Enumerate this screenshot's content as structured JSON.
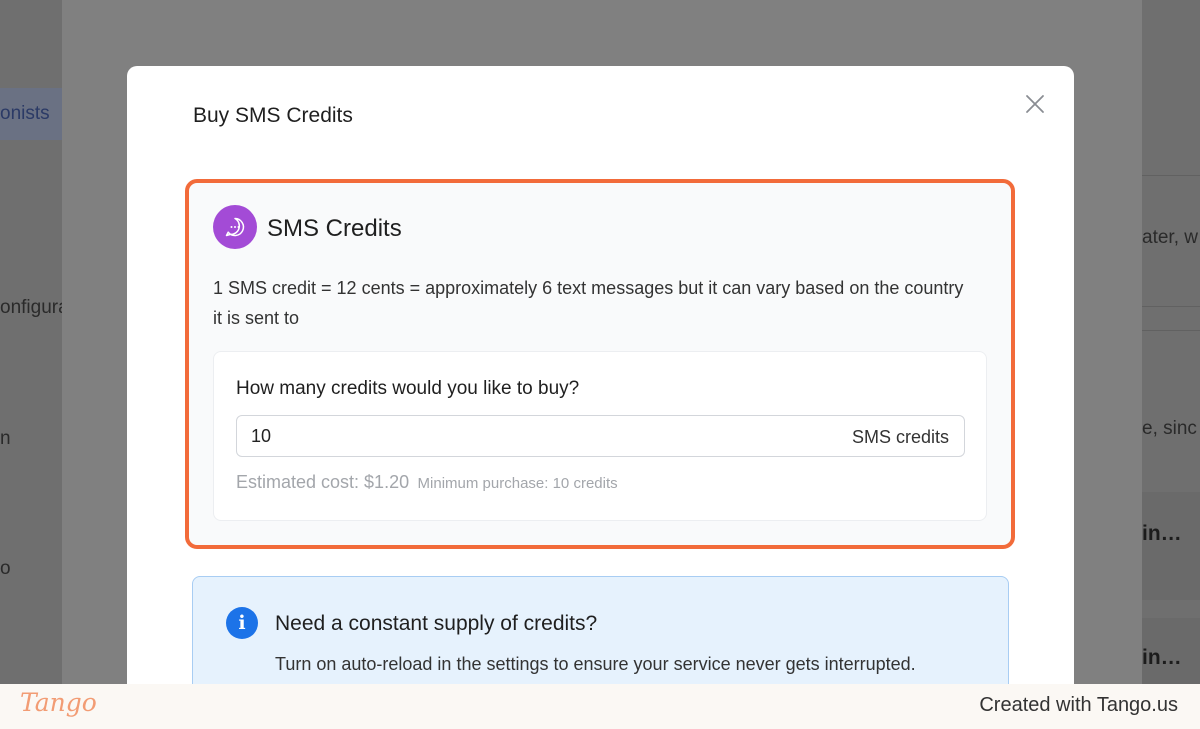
{
  "background": {
    "nav_active_label": "onists",
    "nav_items": [
      "onfigura",
      "n",
      "o"
    ],
    "right_snippets": [
      "ater, w",
      "e, sinc"
    ],
    "right_bold": [
      "in…",
      "in…"
    ]
  },
  "modal": {
    "title": "Buy SMS Credits",
    "close_icon": "close-icon"
  },
  "credits_card": {
    "icon": "chat-bubble-icon",
    "title": "SMS Credits",
    "description": "1 SMS credit = 12 cents = approximately 6 text messages but it can vary based on the country it is sent to",
    "question": "How many credits would you like to buy?",
    "quantity_value": "10",
    "quantity_suffix": "SMS credits",
    "estimated_cost": "Estimated cost: $1.20",
    "minimum_purchase": "Minimum purchase: 10 credits"
  },
  "info_box": {
    "icon": "info-icon",
    "icon_glyph": "i",
    "title": "Need a constant supply of credits?",
    "text": "Turn on auto-reload in the settings to ensure your service never gets interrupted."
  },
  "footer": {
    "logo": "Tango",
    "text": "Created with Tango.us"
  },
  "colors": {
    "highlight_border": "#f26b3a",
    "chat_icon_bg": "#a34bd6",
    "info_icon_bg": "#1c73e8",
    "info_box_bg": "#e6f2fd"
  }
}
